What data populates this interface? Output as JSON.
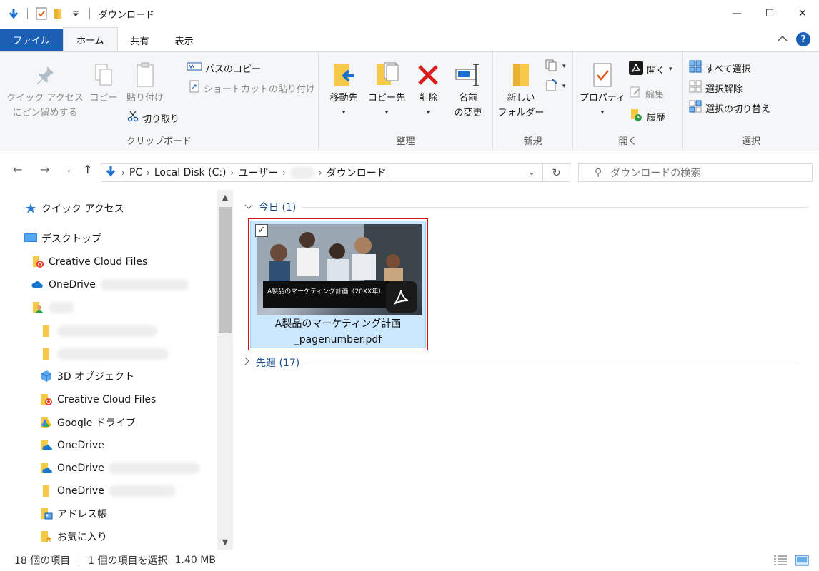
{
  "window": {
    "title": "ダウンロード",
    "minimize": "—",
    "maximize": "☐",
    "close": "✕"
  },
  "tabs": [
    {
      "label": "ファイル"
    },
    {
      "label": "ホーム"
    },
    {
      "label": "共有"
    },
    {
      "label": "表示"
    }
  ],
  "ribbon": {
    "clipboard": {
      "pin_line1": "クイック アクセス",
      "pin_line2": "にピン留めする",
      "copy": "コピー",
      "paste": "貼り付け",
      "copy_path": "パスのコピー",
      "paste_shortcut": "ショートカットの貼り付け",
      "cut": "切り取り",
      "label": "クリップボード"
    },
    "organize": {
      "move_to": "移動先",
      "copy_to": "コピー先",
      "delete": "削除",
      "rename_line1": "名前",
      "rename_line2": "の変更",
      "label": "整理"
    },
    "new": {
      "new_folder_line1": "新しい",
      "new_folder_line2": "フォルダー",
      "label": "新規"
    },
    "open": {
      "properties": "プロパティ",
      "open": "開く",
      "edit": "編集",
      "history": "履歴",
      "label": "開く"
    },
    "select": {
      "select_all": "すべて選択",
      "select_none": "選択解除",
      "invert": "選択の切り替え",
      "label": "選択"
    }
  },
  "address": {
    "crumbs": [
      "PC",
      "Local Disk (C:)",
      "ユーザー",
      "ダウンロード"
    ],
    "search_placeholder": "ダウンロードの検索"
  },
  "nav": {
    "quick_access": "クイック アクセス",
    "desktop": "デスクトップ",
    "creative_cloud_1": "Creative Cloud Files",
    "onedrive_1": "OneDrive",
    "objects3d": "3D オブジェクト",
    "creative_cloud_2": "Creative Cloud Files",
    "google_drive": "Google ドライブ",
    "onedrive_2": "OneDrive",
    "onedrive_3": "OneDrive",
    "onedrive_4": "OneDrive",
    "address_book": "アドレス帳",
    "favorites": "お気に入り"
  },
  "content": {
    "group_today": "今日 (1)",
    "group_last_week": "先週 (17)",
    "file": {
      "name_line1": "A製品のマーケティング計画",
      "name_line2": "_pagenumber.pdf",
      "thumb_title": "A製品のマーケティング計画（20XX年）"
    }
  },
  "status": {
    "count": "18 個の項目",
    "selection": "1 個の項目を選択",
    "size": "1.40 MB"
  },
  "colors": {
    "accent": "#1b5fb4",
    "selection_fill": "#cce8ff",
    "selection_outline": "#dd1111"
  }
}
